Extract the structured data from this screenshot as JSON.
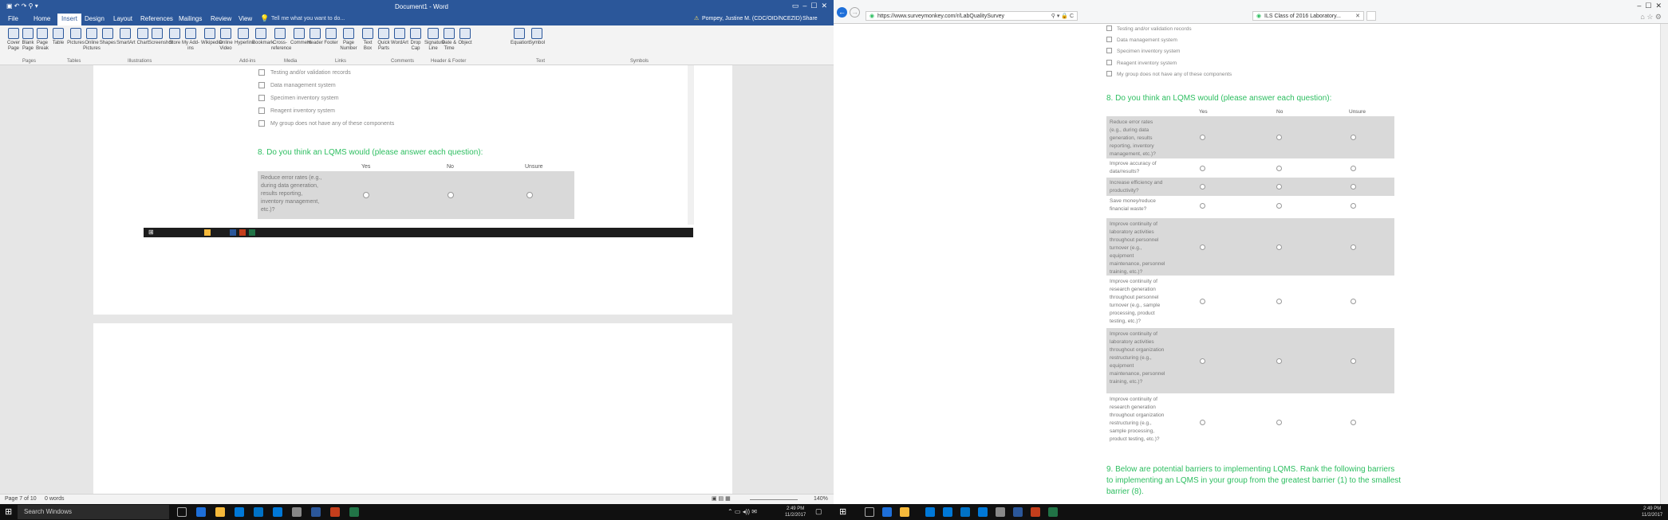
{
  "word": {
    "title": "Document1 - Word",
    "tell_me": "Tell me what you want to do...",
    "user": "Pompey, Justine M. (CDC/OID/NCEZID)",
    "share": "Share",
    "tabs": [
      "File",
      "Home",
      "Insert",
      "Design",
      "Layout",
      "References",
      "Mailings",
      "Review",
      "View"
    ],
    "ribbon": {
      "buttons": [
        "Cover Page",
        "Blank Page",
        "Page Break",
        "Table",
        "Pictures",
        "Online Pictures",
        "Shapes",
        "SmartArt",
        "Chart",
        "Screenshot",
        "Store",
        "My Add-ins",
        "Wikipedia",
        "Online Video",
        "Hyperlink",
        "Bookmark",
        "Cross-reference",
        "Comment",
        "Header",
        "Footer",
        "Page Number",
        "Text Box",
        "Quick Parts",
        "WordArt",
        "Drop Cap",
        "Signature Line",
        "Date & Time",
        "Object",
        "Equation",
        "Symbol"
      ],
      "groups": [
        "Pages",
        "Tables",
        "Illustrations",
        "Add-ins",
        "Media",
        "Links",
        "Comments",
        "Header & Footer",
        "Text",
        "Symbols"
      ]
    },
    "doc": {
      "options": [
        "Testing and/or validation records",
        "Data management system",
        "Specimen inventory system",
        "Reagent inventory system",
        "My group does not have any of these components"
      ],
      "question": "8. Do you think an LQMS would (please answer each question):",
      "columns": [
        "Yes",
        "No",
        "Unsure"
      ],
      "row1": "Reduce error rates (e.g., during data generation, results reporting, inventory management, etc.)?"
    },
    "status": {
      "page": "Page 7 of 10",
      "words": "0 words",
      "zoom": "140%"
    }
  },
  "ie": {
    "url": "https://www.surveymonkey.com/r/LabQualitySurvey",
    "tab": "ILS Class of 2016 Laboratory...",
    "options": [
      "Testing and/or validation records",
      "Data management system",
      "Specimen inventory system",
      "Reagent inventory system",
      "My group does not have any of these components"
    ],
    "question": "8. Do you think an LQMS would (please answer each question):",
    "columns": [
      "Yes",
      "No",
      "Unsure"
    ],
    "rows": [
      "Reduce error rates (e.g., during data generation, results reporting, inventory management, etc.)?",
      "Improve accuracy of data/results?",
      "Increase efficiency and productivity?",
      "Save money/reduce financial waste?",
      "Improve continuity of laboratory activities throughout personnel turnover (e.g., equipment maintenance, personnel training, etc.)?",
      "Improve continuity of research generation throughout personnel turnover (e.g., sample processing, product testing, etc.)?",
      "Improve continuity of laboratory activities throughout organization restructuring (e.g., equipment maintenance, personnel training, etc.)?",
      "Improve continuity of research generation throughout organization restructuring (e.g., sample processing, product testing, etc.)?"
    ],
    "question9": "9. Below are potential barriers to implementing LQMS. Rank the following barriers to implementing an LQMS in your group from the greatest barrier (1) to the smallest barrier (8)."
  },
  "taskbar": {
    "search": "Search Windows",
    "time_left": "2:49 PM",
    "date_left": "11/2/2017",
    "time_right": "2:49 PM",
    "date_right": "11/2/2017"
  },
  "colors": {
    "word_blue": "#2b579a",
    "survey_green": "#2dbe60",
    "row_gray": "#d9d9d9"
  }
}
